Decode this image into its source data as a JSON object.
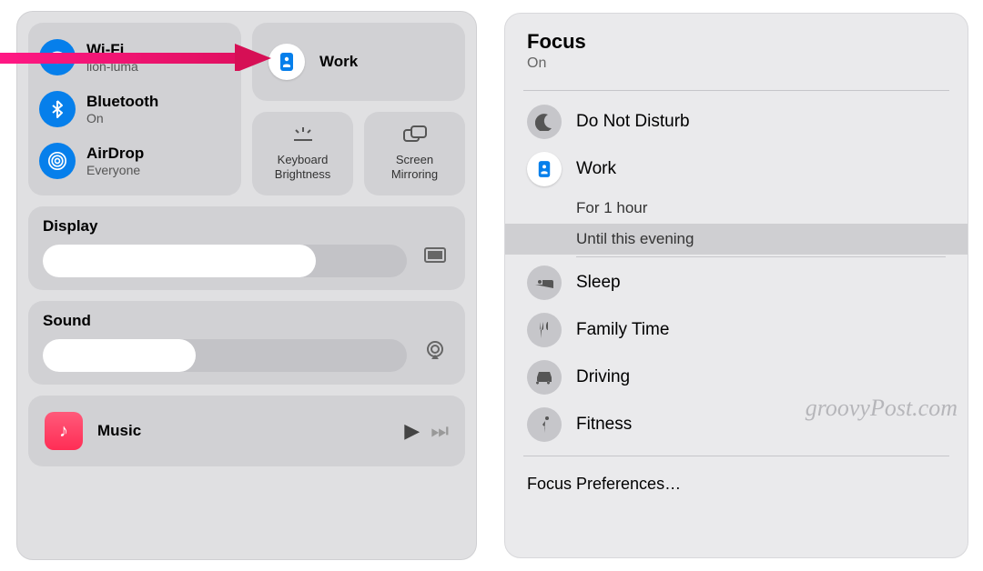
{
  "control_center": {
    "wifi": {
      "title": "Wi-Fi",
      "sub": "lion-luma"
    },
    "bluetooth": {
      "title": "Bluetooth",
      "sub": "On"
    },
    "airdrop": {
      "title": "AirDrop",
      "sub": "Everyone"
    },
    "focus": {
      "title": "Work"
    },
    "keyboard_brightness": "Keyboard\nBrightness",
    "screen_mirroring": "Screen\nMirroring",
    "display": {
      "label": "Display"
    },
    "sound": {
      "label": "Sound"
    },
    "music": {
      "label": "Music"
    }
  },
  "focus_panel": {
    "title": "Focus",
    "status": "On",
    "modes": {
      "dnd": "Do Not Disturb",
      "work": "Work",
      "sleep": "Sleep",
      "family": "Family Time",
      "driving": "Driving",
      "fitness": "Fitness"
    },
    "work_options": {
      "for_hour": "For 1 hour",
      "until_evening": "Until this evening"
    },
    "prefs": "Focus Preferences…"
  },
  "watermark": "groovyPost.com"
}
